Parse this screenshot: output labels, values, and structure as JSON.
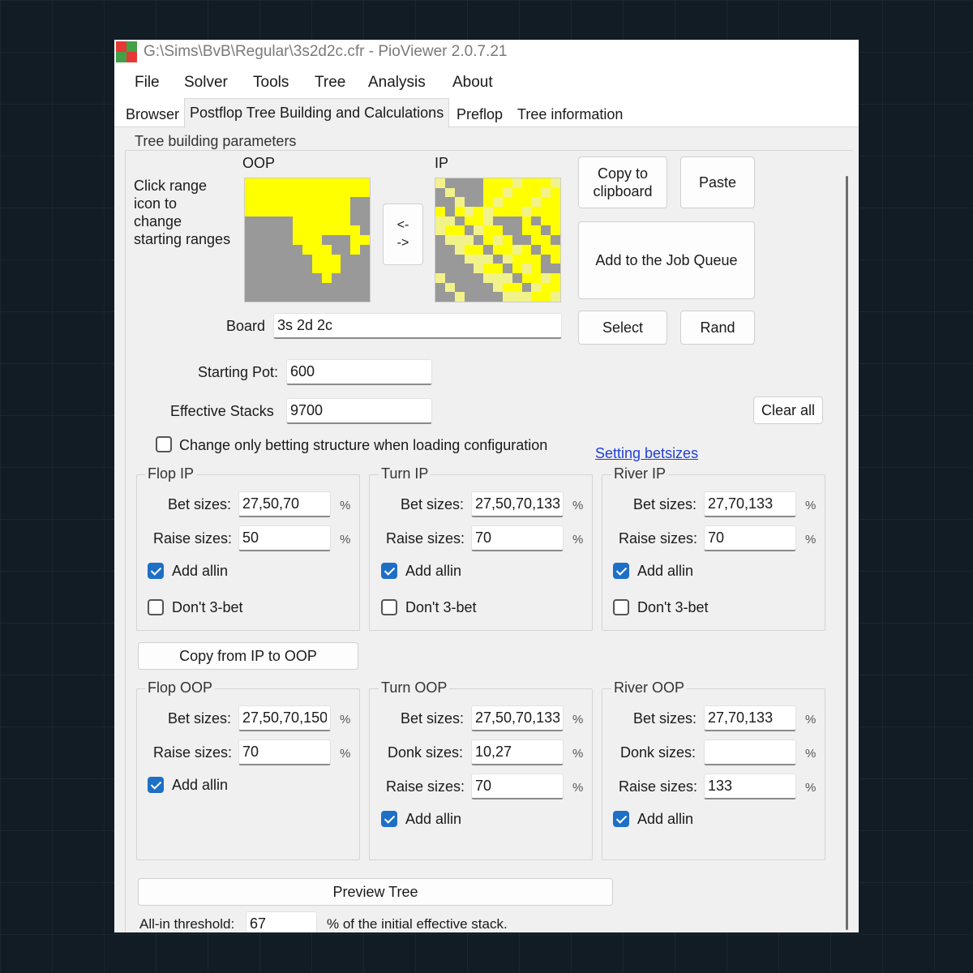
{
  "window": {
    "title": "G:\\Sims\\BvB\\Regular\\3s2d2c.cfr - PioViewer 2.0.7.21"
  },
  "menu": [
    "File",
    "Solver",
    "Tools",
    "Tree",
    "Analysis",
    "About"
  ],
  "tabs": [
    {
      "label": "Browser",
      "active": false
    },
    {
      "label": "Postflop Tree Building and Calculations",
      "active": true
    },
    {
      "label": "Preflop",
      "active": false
    },
    {
      "label": "Tree information",
      "active": false
    }
  ],
  "tree_params": {
    "group_title": "Tree building parameters",
    "click_hint": [
      "Click range",
      "icon to",
      "change",
      "starting ranges"
    ],
    "oop_label": "OOP",
    "ip_label": "IP",
    "swap_button": [
      "<-",
      "->"
    ],
    "board_label": "Board",
    "board_value": "3s 2d 2c",
    "starting_pot_label": "Starting Pot:",
    "starting_pot_value": "600",
    "effective_stacks_label": "Effective Stacks",
    "effective_stacks_value": "9700",
    "change_only_label": "Change only betting structure when loading configuration",
    "change_only_checked": false,
    "setting_betsizes_link": "Setting betsizes"
  },
  "buttons": {
    "copy_clipboard": "Copy to clipboard",
    "paste": "Paste",
    "add_job": "Add to the Job Queue",
    "select": "Select",
    "rand": "Rand",
    "clear_all": "Clear all",
    "copy_ip_to_oop": "Copy from IP to OOP",
    "preview_tree": "Preview Tree"
  },
  "labels": {
    "bet_sizes": "Bet sizes:",
    "raise_sizes": "Raise sizes:",
    "donk_sizes": "Donk sizes:",
    "add_allin": "Add allin",
    "dont_3bet": "Don't 3-bet",
    "pct": "%"
  },
  "ip_groups": {
    "flop": {
      "title": "Flop IP",
      "bet": "27,50,70",
      "raise": "50",
      "allin": true,
      "dont3bet": false
    },
    "turn": {
      "title": "Turn IP",
      "bet": "27,50,70,133",
      "raise": "70",
      "allin": true,
      "dont3bet": false
    },
    "river": {
      "title": "River IP",
      "bet": "27,70,133",
      "raise": "70",
      "allin": true,
      "dont3bet": false
    }
  },
  "oop_groups": {
    "flop": {
      "title": "Flop OOP",
      "bet": "27,50,70,150",
      "raise": "70",
      "allin": true
    },
    "turn": {
      "title": "Turn OOP",
      "bet": "27,50,70,133",
      "donk": "10,27",
      "raise": "70",
      "allin": true
    },
    "river": {
      "title": "River OOP",
      "bet": "27,70,133",
      "donk": "",
      "raise": "133",
      "allin": true
    }
  },
  "allin_threshold": {
    "label": "All-in threshold:",
    "value": "67",
    "suffix": "% of the initial effective stack."
  },
  "colors": {
    "range_yellow": "#ffff00",
    "range_light_yellow": "#f2f28a",
    "range_gray": "#999999",
    "checkbox_blue": "#1e6fc6",
    "link_blue": "#1f3fd6"
  }
}
